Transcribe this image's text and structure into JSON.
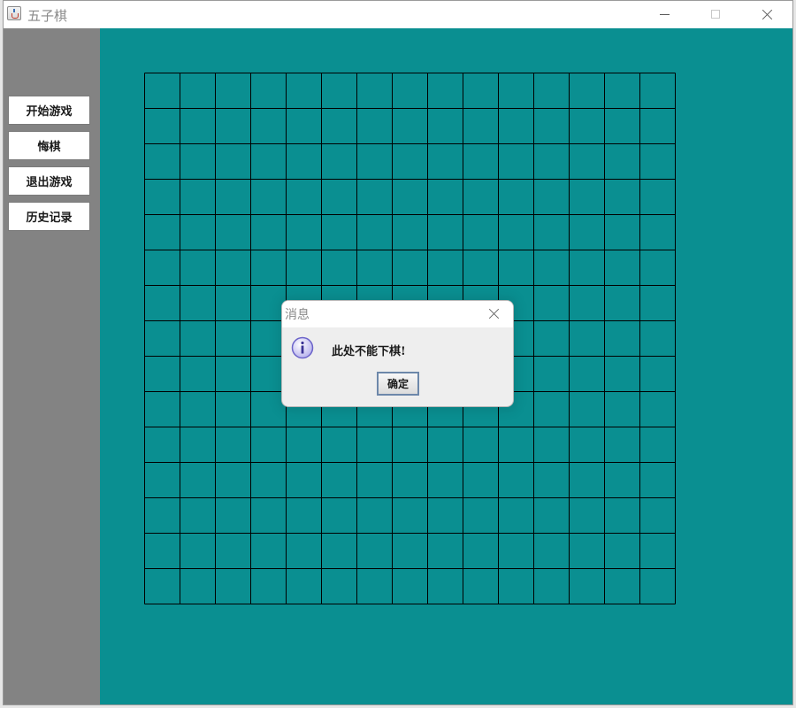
{
  "window": {
    "title": "五子棋"
  },
  "sidebar": {
    "buttons": [
      {
        "label": "开始游戏"
      },
      {
        "label": "悔棋"
      },
      {
        "label": "退出游戏"
      },
      {
        "label": "历史记录"
      }
    ]
  },
  "board": {
    "cells": 15,
    "background": "#0a8f91",
    "line_color": "#000000"
  },
  "dialog": {
    "title": "消息",
    "message": "此处不能下棋!",
    "ok_label": "确定",
    "icon": "info-icon"
  },
  "colors": {
    "sidebar": "#838383",
    "board": "#0a8f91"
  }
}
